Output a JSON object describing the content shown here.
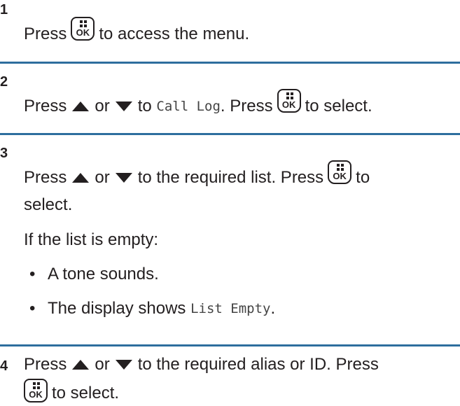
{
  "steps": [
    {
      "number": "1",
      "parts": {
        "a": "Press",
        "b": "to access the menu."
      }
    },
    {
      "number": "2",
      "parts": {
        "a": "Press",
        "b": "or",
        "c": "to",
        "menu_item": "Call Log",
        "d": ". Press",
        "e": "to select."
      }
    },
    {
      "number": "3",
      "parts": {
        "a": "Press",
        "b": "or",
        "c": "to the required list. Press",
        "d": "to",
        "e": "select.",
        "empty_intro": "If the list is empty:",
        "bullet1": "A tone sounds.",
        "bullet2_a": "The display shows",
        "bullet2_mono": "List Empty",
        "bullet2_b": "."
      }
    },
    {
      "number": "4",
      "parts": {
        "a": "Press",
        "b": "or",
        "c": "to the required alias or ID. Press",
        "d": "to select."
      }
    }
  ],
  "icons": {
    "ok_key": "menu-ok-key-icon",
    "up": "up-arrow-icon",
    "down": "down-arrow-icon",
    "ok_key_label": "OK"
  },
  "colors": {
    "separator": "#2e6e9e",
    "text": "#231f20"
  }
}
